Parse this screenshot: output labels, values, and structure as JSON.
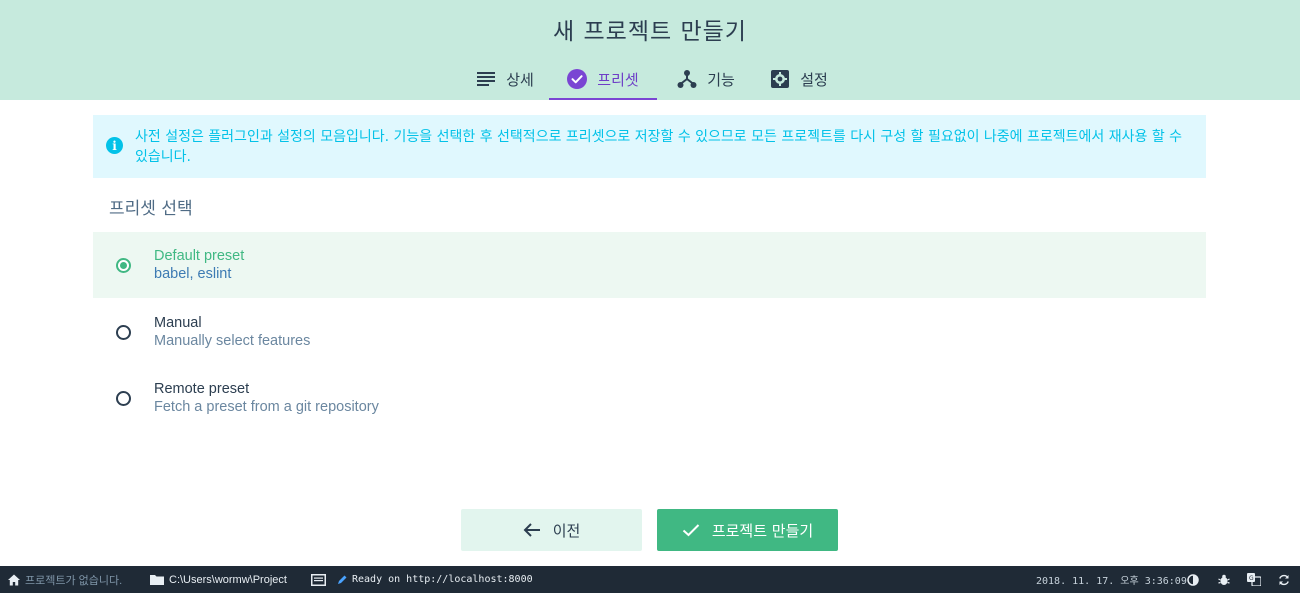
{
  "header": {
    "title": "새 프로젝트 만들기",
    "tabs": [
      {
        "label": "상세",
        "icon": "list-icon"
      },
      {
        "label": "프리셋",
        "icon": "check-circle-icon",
        "active": true
      },
      {
        "label": "기능",
        "icon": "fork-icon"
      },
      {
        "label": "설정",
        "icon": "gear-icon"
      }
    ]
  },
  "info": {
    "text": "사전 설정은 플러그인과 설정의 모음입니다. 기능을 선택한 후 선택적으로 프리셋으로 저장할 수 있으므로 모든 프로젝트를 다시 구성 할 필요없이 나중에 프로젝트에서 재사용 할 수 있습니다.",
    "icon": "info-icon"
  },
  "section": {
    "title": "프리셋 선택"
  },
  "options": [
    {
      "name": "Default preset",
      "desc": "babel, eslint",
      "selected": true
    },
    {
      "name": "Manual",
      "desc": "Manually select features",
      "selected": false
    },
    {
      "name": "Remote preset",
      "desc": "Fetch a preset from a git repository",
      "selected": false
    }
  ],
  "buttons": {
    "prev": "이전",
    "create": "프로젝트 만들기"
  },
  "statusbar": {
    "project": "프로젝트가 없습니다.",
    "path": "C:\\Users\\wormw\\Project",
    "log": "Ready on http://localhost:8000",
    "datetime": "2018. 11. 17. 오후 3:36:09"
  },
  "colors": {
    "accent": "#40b883",
    "header_bg": "#c6eadd",
    "tab_active": "#7a45d3",
    "info": "#03c2e8",
    "statusbar_bg": "#1f2a36"
  }
}
